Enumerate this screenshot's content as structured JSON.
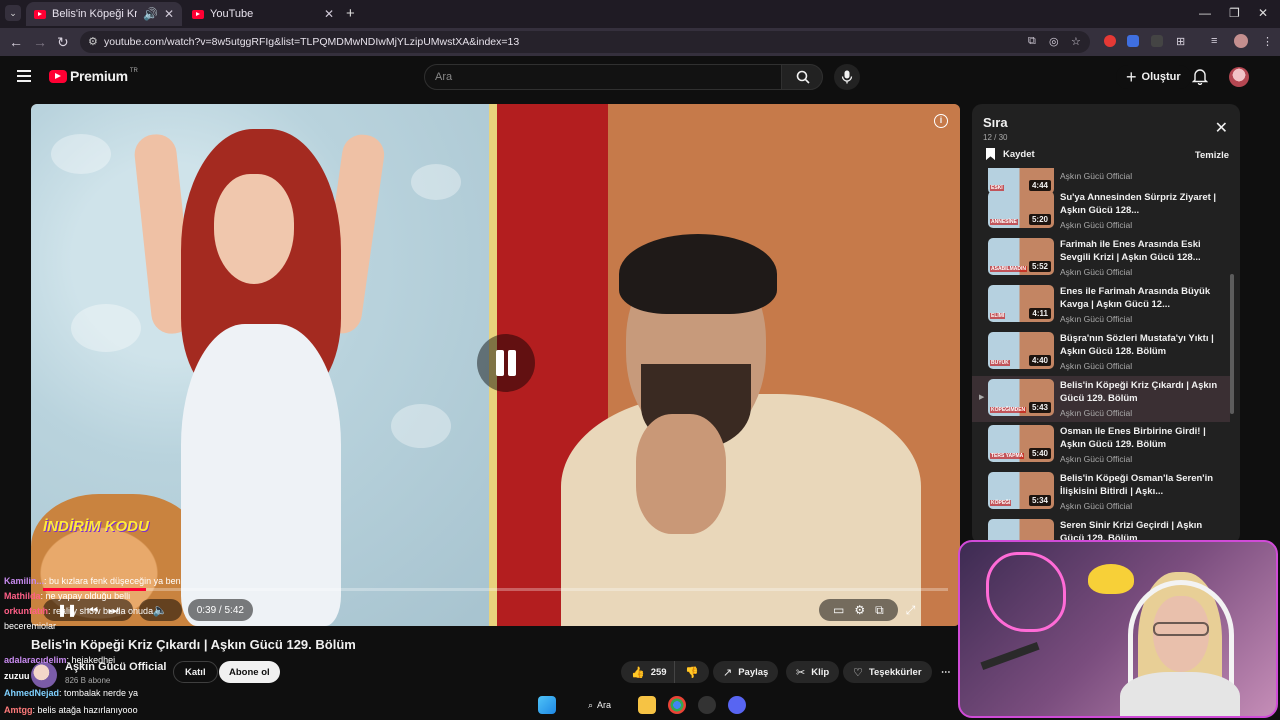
{
  "browser": {
    "tabs": [
      {
        "title": "Belis'in Köpeği Kriz Çıkardı",
        "active": true
      },
      {
        "title": "YouTube",
        "active": false
      }
    ],
    "url": "youtube.com/watch?v=8w5utggRFIg&list=TLPQMDMwNDIwMjYLzipUMwstXA&index=13"
  },
  "header": {
    "logo_text": "Premium",
    "logo_region": "TR",
    "search_placeholder": "Ara",
    "create_label": "Oluştur"
  },
  "player": {
    "time": "0:39 / 5:42",
    "progress": 0.114,
    "promo_text": "İNDİRİM KODU"
  },
  "video": {
    "title": "Belis'in Köpeği Kriz Çıkardı | Aşkın Gücü 129. Bölüm",
    "channel": "Aşkın Gücü Official",
    "subscribers": "826 B abone",
    "join_label": "Katıl",
    "subscribe_label": "Abone ol",
    "likes": "259",
    "share_label": "Paylaş",
    "clip_label": "Klip",
    "thanks_label": "Teşekkürler"
  },
  "queue": {
    "title": "Sıra",
    "count": "12 / 30",
    "save_label": "Kaydet",
    "clear_label": "Temizle",
    "items": [
      {
        "title": "",
        "channel": "Aşkın Gücü Official",
        "duration": "4:44",
        "caption": "ESKİ",
        "active": false
      },
      {
        "title": "Su'ya Annesinden Sürpriz Ziyaret | Aşkın Gücü 128...",
        "channel": "Aşkın Gücü Official",
        "duration": "5:20",
        "caption": "ANNESİNE",
        "active": false
      },
      {
        "title": "Farimah ile Enes Arasında Eski Sevgili Krizi | Aşkın Gücü 128...",
        "channel": "Aşkın Gücü Official",
        "duration": "5:52",
        "caption": "ASABILMADIN",
        "active": false
      },
      {
        "title": "Enes ile Farimah Arasında Büyük Kavga | Aşkın Gücü 12...",
        "channel": "Aşkın Gücü Official",
        "duration": "4:11",
        "caption": "ELİMİ",
        "active": false
      },
      {
        "title": "Büşra'nın Sözleri Mustafa'yı Yıktı | Aşkın Gücü 128. Bölüm",
        "channel": "Aşkın Gücü Official",
        "duration": "4:40",
        "caption": "BUYUK",
        "active": false
      },
      {
        "title": "Belis'in Köpeği Kriz Çıkardı | Aşkın Gücü 129. Bölüm",
        "channel": "Aşkın Gücü Official",
        "duration": "5:43",
        "caption": "KÖPEĞİMDEN",
        "active": true
      },
      {
        "title": "Osman ile Enes Birbirine Girdi! | Aşkın Gücü 129. Bölüm",
        "channel": "Aşkın Gücü Official",
        "duration": "5:40",
        "caption": "TERS YAPMA",
        "active": false
      },
      {
        "title": "Belis'in Köpeği Osman'la Seren'in İlişkisini Bitirdi | Aşkı...",
        "channel": "Aşkın Gücü Official",
        "duration": "5:34",
        "caption": "KÖPEĞİ",
        "active": false
      },
      {
        "title": "Seren Sinir Krizi Geçirdi | Aşkın Gücü 129. Bölüm",
        "channel": "",
        "duration": "",
        "caption": "",
        "active": false
      }
    ]
  },
  "chat": [
    {
      "user": "Kamilin...",
      "text": ": bu kızlara fenk düşeceğin ya ben",
      "color": "#c88bf0"
    },
    {
      "user": "Mathilda",
      "text": ": ne yapay olduğu belli",
      "color": "#ff5f87"
    },
    {
      "user": "orkunfatıh",
      "text": ": reality show bu da onuda",
      "color": "#ff5f87"
    },
    {
      "user": "",
      "text": "beceremiolar",
      "color": "#ffffff"
    },
    {
      "user": "adalaracıdelim",
      "text": ": hejakedhei",
      "color": "#c88bf0"
    },
    {
      "user": "zuzuu",
      "text": "",
      "color": "#ffffff"
    },
    {
      "user": "AhmedNejad",
      "text": ": tombalak nerde ya",
      "color": "#7fd1ff"
    },
    {
      "user": "Amtgg",
      "text": ": belis atağa hazırlanıyooo",
      "color": "#ff7a7a"
    }
  ],
  "taskbar": {
    "search_label": "Ara"
  },
  "colors": {
    "youtube_red": "#ff0033",
    "panel_bg": "#212121",
    "page_bg": "#0f0f0f"
  }
}
